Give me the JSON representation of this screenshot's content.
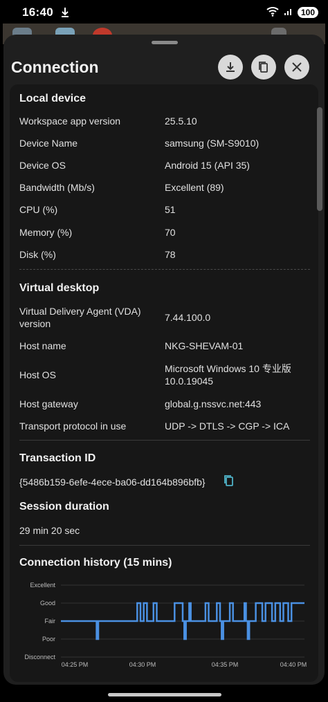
{
  "status_bar": {
    "time": "16:40",
    "battery": "100"
  },
  "sheet": {
    "title": "Connection",
    "buttons": {
      "download": "download-icon",
      "copy": "copy-icon",
      "close": "close-icon"
    }
  },
  "local_device": {
    "title": "Local device",
    "rows": [
      {
        "label": "Workspace app version",
        "value": "25.5.10"
      },
      {
        "label": "Device Name",
        "value": "samsung (SM-S9010)"
      },
      {
        "label": "Device OS",
        "value": "Android 15 (API 35)"
      },
      {
        "label": "Bandwidth (Mb/s)",
        "value": "Excellent (89)"
      },
      {
        "label": "CPU (%)",
        "value": "51"
      },
      {
        "label": "Memory (%)",
        "value": "70"
      },
      {
        "label": "Disk (%)",
        "value": "78"
      }
    ]
  },
  "virtual_desktop": {
    "title": "Virtual desktop",
    "rows": [
      {
        "label": "Virtual Delivery Agent (VDA) version",
        "value": "7.44.100.0"
      },
      {
        "label": "Host name",
        "value": "NKG-SHEVAM-01"
      },
      {
        "label": "Host OS",
        "value": "Microsoft Windows 10 专业版 10.0.19045"
      },
      {
        "label": "Host gateway",
        "value": "global.g.nssvc.net:443"
      },
      {
        "label": "Transport protocol in use",
        "value": "UDP -> DTLS -> CGP -> ICA"
      }
    ]
  },
  "transaction": {
    "title": "Transaction ID",
    "value": "{5486b159-6efe-4ece-ba06-dd164b896bfb}"
  },
  "session": {
    "title": "Session duration",
    "value": "29 min 20 sec"
  },
  "history": {
    "title": "Connection history (15 mins)"
  },
  "colors": {
    "line": "#4a90e2",
    "background": "#1f1f1f",
    "card": "#171717"
  },
  "chart_data": {
    "type": "line",
    "y_categories": [
      "Excellent",
      "Good",
      "Fair",
      "Poor",
      "Disconnect"
    ],
    "x_ticks": [
      "04:25 PM",
      "04:30 PM",
      "04:35 PM",
      "04:40 PM"
    ],
    "x_range_min": [
      0,
      15
    ],
    "series": [
      {
        "points": [
          [
            0,
            "Fair"
          ],
          [
            2.2,
            "Fair"
          ],
          [
            2.2,
            "Poor"
          ],
          [
            2.3,
            "Poor"
          ],
          [
            2.3,
            "Fair"
          ],
          [
            4.7,
            "Fair"
          ],
          [
            4.7,
            "Good"
          ],
          [
            4.9,
            "Good"
          ],
          [
            4.9,
            "Fair"
          ],
          [
            5.1,
            "Fair"
          ],
          [
            5.1,
            "Good"
          ],
          [
            5.3,
            "Good"
          ],
          [
            5.3,
            "Fair"
          ],
          [
            5.7,
            "Fair"
          ],
          [
            5.7,
            "Good"
          ],
          [
            5.9,
            "Good"
          ],
          [
            5.9,
            "Fair"
          ],
          [
            7.0,
            "Fair"
          ],
          [
            7.0,
            "Good"
          ],
          [
            7.5,
            "Good"
          ],
          [
            7.5,
            "Fair"
          ],
          [
            7.6,
            "Fair"
          ],
          [
            7.6,
            "Poor"
          ],
          [
            7.7,
            "Poor"
          ],
          [
            7.7,
            "Fair"
          ],
          [
            7.9,
            "Fair"
          ],
          [
            7.9,
            "Good"
          ],
          [
            8.0,
            "Good"
          ],
          [
            8.0,
            "Fair"
          ],
          [
            8.9,
            "Fair"
          ],
          [
            8.9,
            "Good"
          ],
          [
            9.1,
            "Good"
          ],
          [
            9.1,
            "Fair"
          ],
          [
            9.6,
            "Fair"
          ],
          [
            9.6,
            "Good"
          ],
          [
            9.8,
            "Good"
          ],
          [
            9.8,
            "Fair"
          ],
          [
            9.9,
            "Fair"
          ],
          [
            9.9,
            "Poor"
          ],
          [
            10.0,
            "Poor"
          ],
          [
            10.0,
            "Fair"
          ],
          [
            10.4,
            "Fair"
          ],
          [
            10.4,
            "Good"
          ],
          [
            10.6,
            "Good"
          ],
          [
            10.6,
            "Fair"
          ],
          [
            11.3,
            "Fair"
          ],
          [
            11.3,
            "Good"
          ],
          [
            11.4,
            "Good"
          ],
          [
            11.4,
            "Fair"
          ],
          [
            11.5,
            "Fair"
          ],
          [
            11.5,
            "Poor"
          ],
          [
            11.6,
            "Poor"
          ],
          [
            11.6,
            "Fair"
          ],
          [
            12.0,
            "Fair"
          ],
          [
            12.0,
            "Good"
          ],
          [
            12.4,
            "Good"
          ],
          [
            12.4,
            "Fair"
          ],
          [
            12.6,
            "Fair"
          ],
          [
            12.6,
            "Good"
          ],
          [
            13.0,
            "Good"
          ],
          [
            13.0,
            "Fair"
          ],
          [
            13.2,
            "Fair"
          ],
          [
            13.2,
            "Good"
          ],
          [
            13.5,
            "Good"
          ],
          [
            13.5,
            "Fair"
          ],
          [
            13.7,
            "Fair"
          ],
          [
            13.7,
            "Good"
          ],
          [
            14.0,
            "Good"
          ],
          [
            14.0,
            "Fair"
          ],
          [
            14.2,
            "Fair"
          ],
          [
            14.2,
            "Good"
          ],
          [
            15.0,
            "Good"
          ]
        ]
      }
    ]
  }
}
